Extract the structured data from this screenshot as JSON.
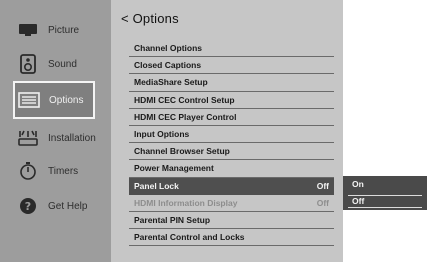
{
  "sidebar": {
    "items": [
      {
        "label": "Picture",
        "icon": "picture-icon"
      },
      {
        "label": "Sound",
        "icon": "speaker-icon"
      },
      {
        "label": "Options",
        "icon": "options-icon",
        "selected": true
      },
      {
        "label": "Installation",
        "icon": "installation-icon"
      },
      {
        "label": "Timers",
        "icon": "timer-icon"
      },
      {
        "label": "Get Help",
        "icon": "help-icon"
      }
    ]
  },
  "main": {
    "title": "< Options",
    "items": [
      {
        "label": "Channel Options",
        "value": ""
      },
      {
        "label": "Closed Captions",
        "value": ""
      },
      {
        "label": "MediaShare Setup",
        "value": ""
      },
      {
        "label": "HDMI CEC Control Setup",
        "value": ""
      },
      {
        "label": "HDMI CEC Player Control",
        "value": ""
      },
      {
        "label": "Input Options",
        "value": ""
      },
      {
        "label": "Channel Browser Setup",
        "value": ""
      },
      {
        "label": "Power Management",
        "value": ""
      },
      {
        "label": "Panel Lock",
        "value": "Off",
        "selected": true
      },
      {
        "label": "HDMI Information Display",
        "value": "Off",
        "disabled": true
      },
      {
        "label": "Parental PIN Setup",
        "value": ""
      },
      {
        "label": "Parental Control and Locks",
        "value": ""
      }
    ]
  },
  "popup": {
    "options": [
      "On",
      "Off"
    ],
    "selected": "Off"
  },
  "colors": {
    "sidebar_bg": "#9d9d9d",
    "menu_bg": "#c6c6c6",
    "highlight_bg": "#4f4f4f",
    "popup_bg": "#4a4a4a"
  }
}
